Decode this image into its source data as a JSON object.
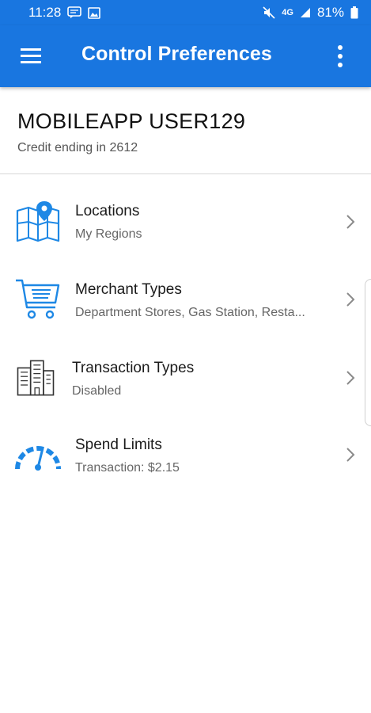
{
  "status": {
    "time": "11:28",
    "battery": "81%",
    "network": "4G"
  },
  "app_bar": {
    "title": "Control Preferences"
  },
  "account": {
    "name": "MOBILEAPP USER129",
    "subtitle": "Credit ending in 2612"
  },
  "items": [
    {
      "title": "Locations",
      "subtitle": "My Regions",
      "icon": "map-pin-icon"
    },
    {
      "title": "Merchant Types",
      "subtitle": "Department Stores, Gas Station, Resta...",
      "icon": "shopping-cart-icon"
    },
    {
      "title": "Transaction Types",
      "subtitle": "Disabled",
      "icon": "buildings-icon"
    },
    {
      "title": "Spend Limits",
      "subtitle": "Transaction: $2.15",
      "icon": "speedometer-icon"
    }
  ],
  "colors": {
    "primary": "#1976e0",
    "icon_blue": "#1e88e5"
  }
}
